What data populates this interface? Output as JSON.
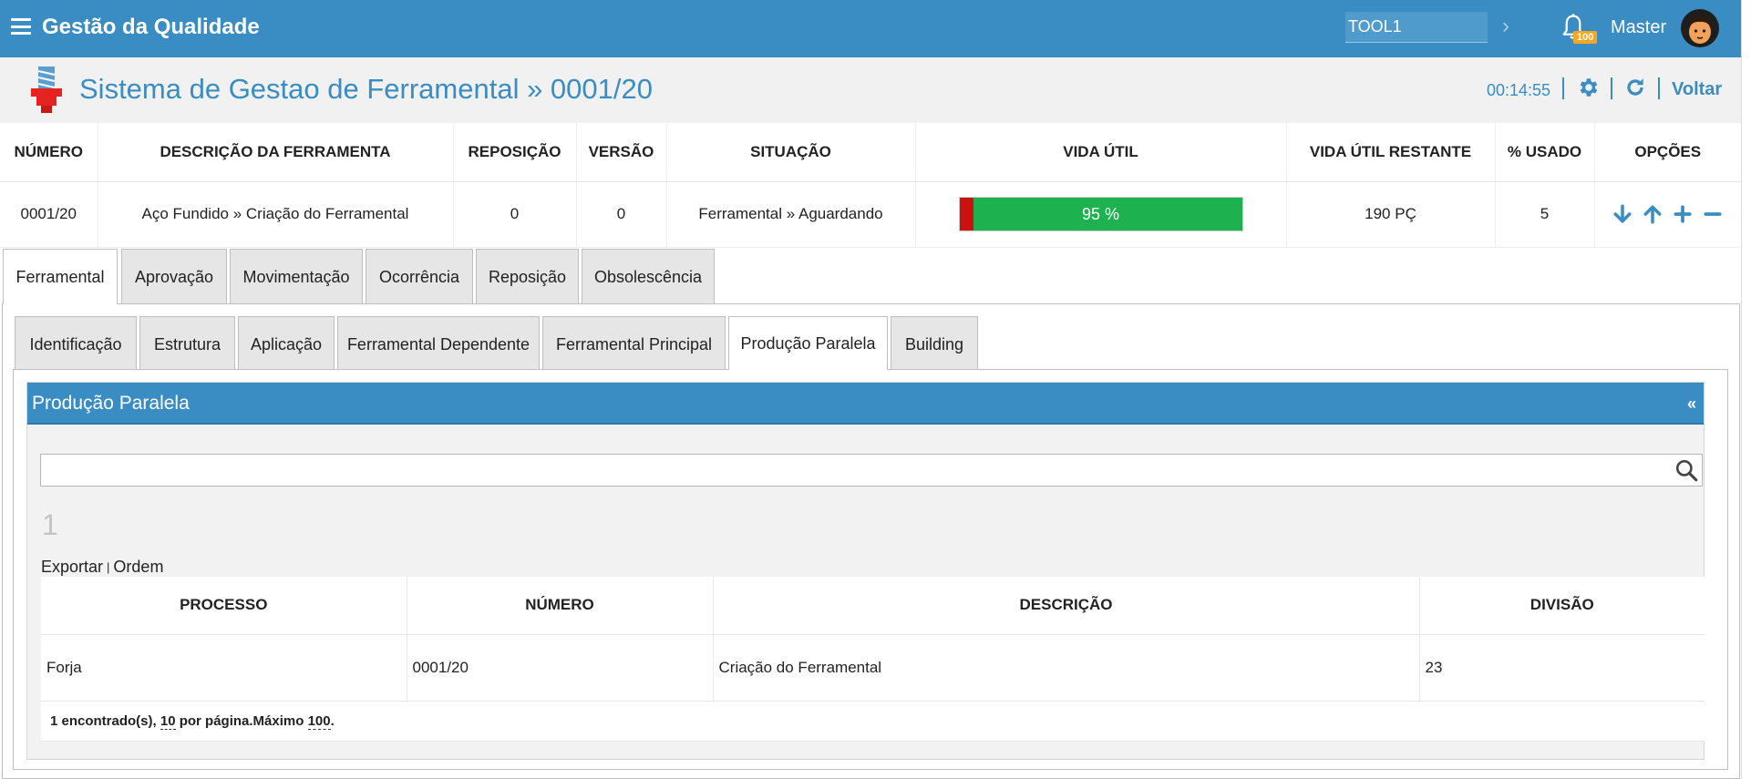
{
  "app": {
    "title": "Gestão da Qualidade",
    "tool_input_value": "TOOL1",
    "notification_count": "100",
    "user_name": "Master",
    "accent_color": "#3a8dc2"
  },
  "page": {
    "title": "Sistema de Gestao de Ferramental » 0001/20",
    "clock": "00:14:55",
    "back_label": "Voltar"
  },
  "summary": {
    "headers": [
      "NÚMERO",
      "DESCRIÇÃO DA FERRAMENTA",
      "REPOSIÇÃO",
      "VERSÃO",
      "SITUAÇÃO",
      "VIDA ÚTIL",
      "VIDA ÚTIL RESTANTE",
      "% USADO",
      "OPÇÕES"
    ],
    "row": {
      "numero": "0001/20",
      "descricao": "Aço Fundido » Criação do Ferramental",
      "reposicao": "0",
      "versao": "0",
      "situacao": "Ferramental » Aguardando",
      "vida_util_label": "95 %",
      "vida_util_remaining_fraction": 0.95,
      "vida_util_restante": "190 PÇ",
      "pct_usado": "5"
    },
    "option_icons": [
      "arrow-down-icon",
      "arrow-up-icon",
      "plus-icon",
      "minus-icon"
    ]
  },
  "tabs": [
    {
      "label": "Ferramental",
      "active": true
    },
    {
      "label": "Aprovação",
      "active": false
    },
    {
      "label": "Movimentação",
      "active": false
    },
    {
      "label": "Ocorrência",
      "active": false
    },
    {
      "label": "Reposição",
      "active": false
    },
    {
      "label": "Obsolescência",
      "active": false
    }
  ],
  "subtabs": [
    {
      "label": "Identificação",
      "active": false
    },
    {
      "label": "Estrutura",
      "active": false
    },
    {
      "label": "Aplicação",
      "active": false
    },
    {
      "label": "Ferramental Dependente",
      "active": false
    },
    {
      "label": "Ferramental Principal",
      "active": false
    },
    {
      "label": "Produção Paralela",
      "active": true
    },
    {
      "label": "Building",
      "active": false
    }
  ],
  "section": {
    "title": "Produção Paralela",
    "collapse_label": "«",
    "search_value": "",
    "page_number": "1",
    "export_label": "Exportar",
    "separator": "|",
    "order_label": "Ordem",
    "table": {
      "headers": [
        "PROCESSO",
        "NÚMERO",
        "DESCRIÇÃO",
        "DIVISÃO"
      ],
      "rows": [
        [
          "Forja",
          "0001/20",
          "Criação do Ferramental",
          "23"
        ]
      ],
      "footer": {
        "found_text": "1 encontrado(s), ",
        "per_page_value": "10",
        "per_page_text": " por página.Máximo ",
        "max_value": "100",
        "end_text": "."
      }
    }
  }
}
